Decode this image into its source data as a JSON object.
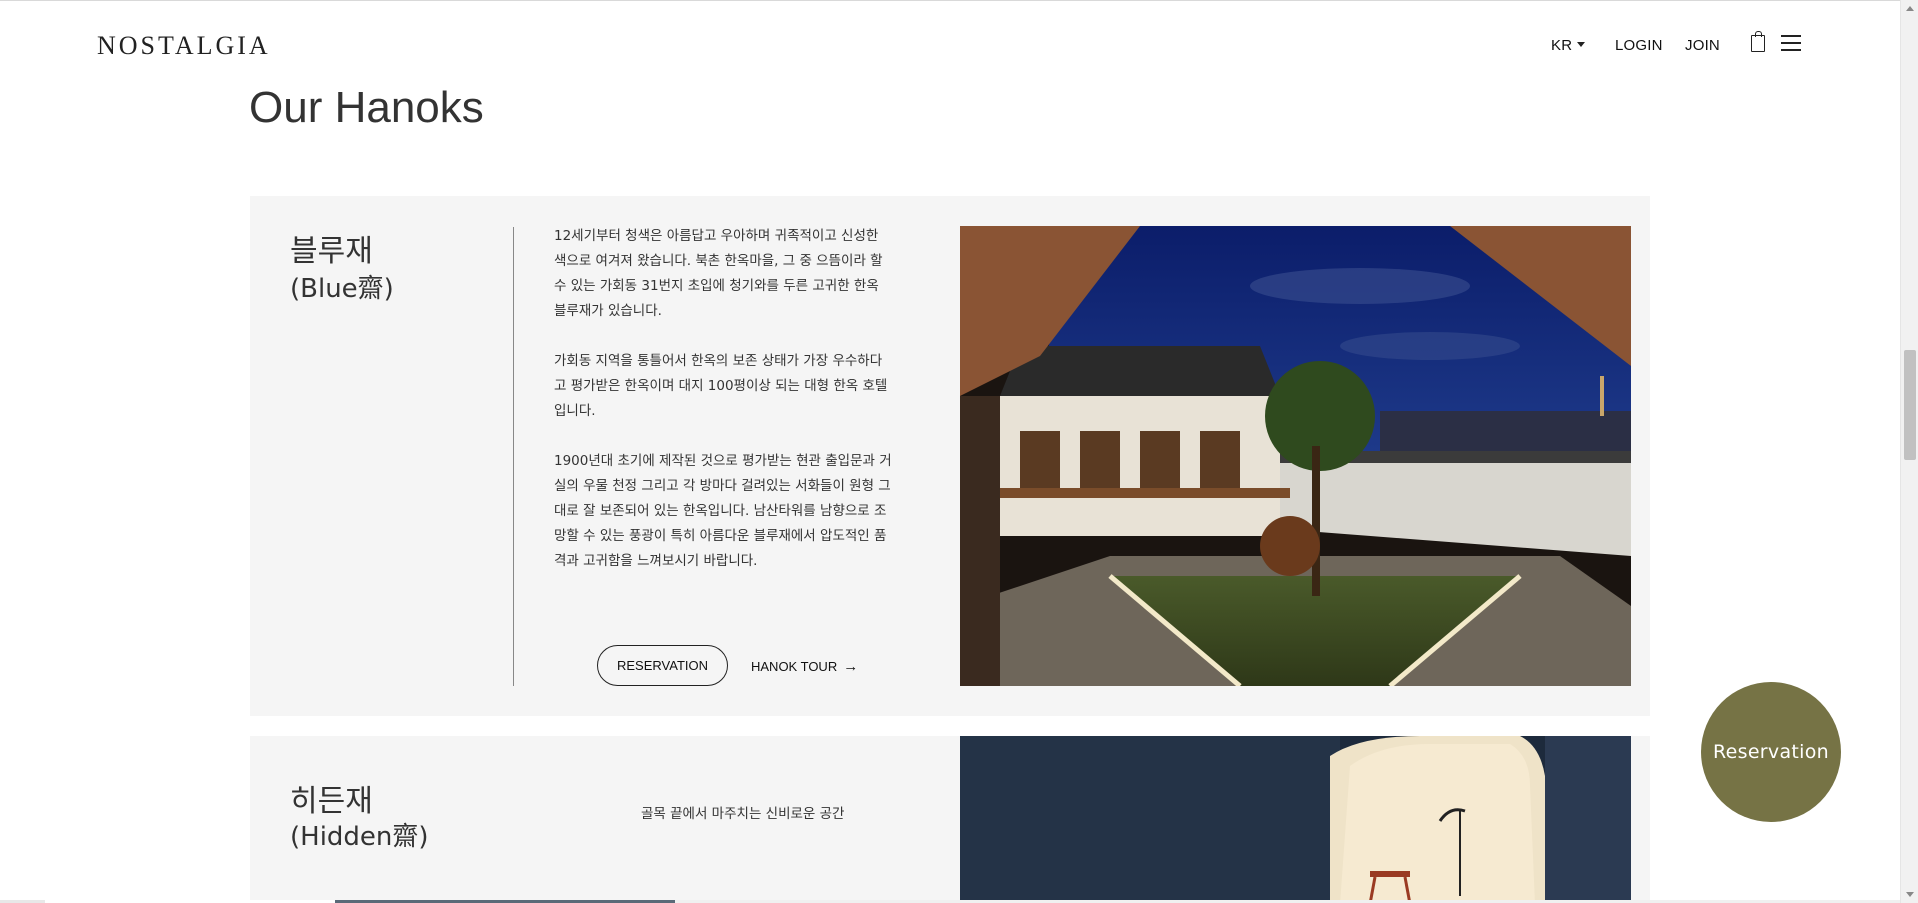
{
  "header": {
    "logo": "NOSTALGIA",
    "lang": "KR",
    "login": "LOGIN",
    "join": "JOIN",
    "icons": [
      "shopping-bag-icon",
      "hamburger-menu-icon"
    ]
  },
  "section_title": "Our Hanoks",
  "hanoks": [
    {
      "name_ko": "블루재",
      "name_en": "(Blue齋)",
      "paragraphs": [
        "12세기부터 청색은 아름답고 우아하며 귀족적이고 신성한 색으로 여겨져 왔습니다. 북촌 한옥마을, 그 중 으뜸이라 할 수 있는 가회동 31번지 초입에 청기와를 두른 고귀한 한옥 블루재가 있습니다.",
        "가회동 지역을 통틀어서 한옥의 보존 상태가 가장 우수하다고 평가받은 한옥이며 대지 100평이상 되는 대형 한옥 호텔입니다.",
        "1900년대 초기에 제작된 것으로 평가받는 현관 출입문과 거실의 우물 천정 그리고 각 방마다 걸려있는 서화들이 원형 그대로 잘 보존되어 있는 한옥입니다. 남산타워를 남향으로 조망할 수 있는 풍광이 특히 아름다운 블루재에서 압도적인 품격과 고귀함을 느껴보시기 바랍니다."
      ],
      "reservation_label": "RESERVATION",
      "tour_label": "HANOK TOUR"
    },
    {
      "name_ko": "히든재",
      "name_en": "(Hidden齋)",
      "tagline": "골목 끝에서 마주치는 신비로운 공간"
    }
  ],
  "float_button": "Reservation",
  "colors": {
    "accent": "#767345",
    "card_bg": "#f5f5f5",
    "text": "#333333"
  }
}
